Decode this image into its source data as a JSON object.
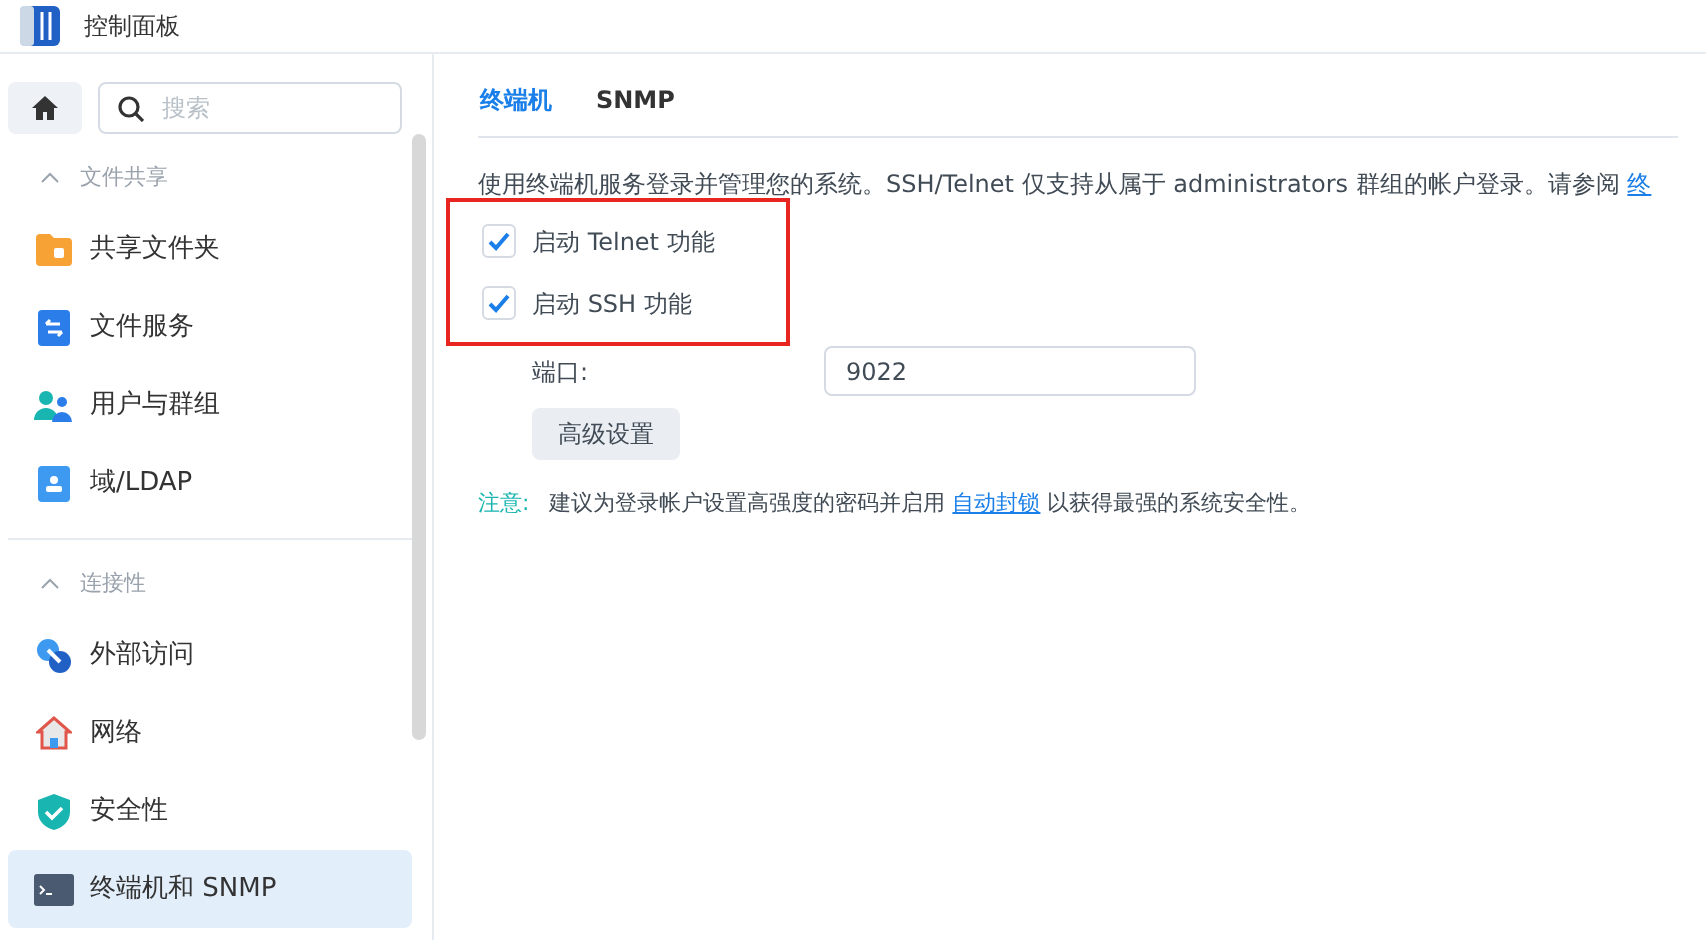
{
  "window": {
    "title": "控制面板"
  },
  "sidebar": {
    "search": {
      "placeholder": "搜索"
    },
    "sections": [
      {
        "title": "文件共享",
        "expanded": true,
        "items": [
          {
            "label": "共享文件夹",
            "selected": false
          },
          {
            "label": "文件服务",
            "selected": false
          },
          {
            "label": "用户与群组",
            "selected": false
          },
          {
            "label": "域/LDAP",
            "selected": false
          }
        ]
      },
      {
        "title": "连接性",
        "expanded": true,
        "items": [
          {
            "label": "外部访问",
            "selected": false
          },
          {
            "label": "网络",
            "selected": false
          },
          {
            "label": "安全性",
            "selected": false
          },
          {
            "label": "终端机和 SNMP",
            "selected": true
          }
        ]
      }
    ]
  },
  "tabs": [
    {
      "label": "终端机",
      "selected": true
    },
    {
      "label": "SNMP",
      "selected": false
    }
  ],
  "description": {
    "text": "使用终端机服务登录并管理您的系统。SSH/Telnet 仅支持从属于 administrators 群组的帐户登录。请参阅",
    "link": "终"
  },
  "options": [
    {
      "label": "启动 Telnet 功能",
      "checked": true
    },
    {
      "label": "启动 SSH 功能",
      "checked": true
    }
  ],
  "port": {
    "label": "端口:",
    "value": "9022"
  },
  "advanced_button": "高级设置",
  "note": {
    "label": "注意:",
    "before": "建议为登录帐户设置高强度的密码并启用",
    "link": "自动封锁",
    "after": "以获得最强的系统安全性。"
  }
}
